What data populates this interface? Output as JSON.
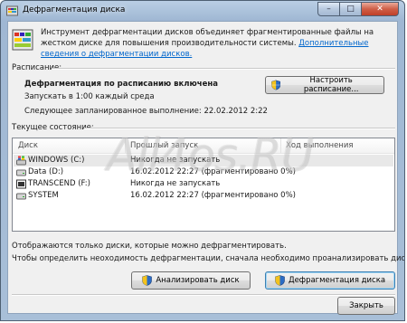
{
  "window": {
    "title": "Дефрагментация диска",
    "buttons": {
      "minimize": "–",
      "maximize": "□",
      "close": "✕"
    }
  },
  "intro": {
    "text": "Инструмент дефрагментации дисков объединяет фрагментированные файлы на жестком диске для повышения производительности системы. ",
    "link": "Дополнительные сведения о дефрагментации дисков."
  },
  "schedule": {
    "label": "Расписание:",
    "status": "Дефрагментация по расписанию включена",
    "run_at": "Запускать в 1:00 каждый среда",
    "next_run": "Следующее запланированное выполнение: 22.02.2012 2:22",
    "configure_button": "Настроить расписание..."
  },
  "current_state": {
    "label": "Текущее состояние:",
    "columns": [
      "Диск",
      "Прошлый запуск",
      "Ход выполнения"
    ],
    "rows": [
      {
        "disk": "WINDOWS (C:)",
        "last_run": "Никогда не запускать",
        "progress": ""
      },
      {
        "disk": "Data (D:)",
        "last_run": "16.02.2012 22:27 (фрагментировано 0%)",
        "progress": ""
      },
      {
        "disk": "TRANSCEND (F:)",
        "last_run": "Никогда не запускать",
        "progress": ""
      },
      {
        "disk": "SYSTEM",
        "last_run": "16.02.2012 22:27 (фрагментировано 0%)",
        "progress": ""
      }
    ]
  },
  "footer": {
    "note1": "Отображаются только диски, которые можно дефрагментировать.",
    "note2": "Чтобы определить неоходимость  дефрагментации, сначала необходимо проанализировать диски.",
    "analyze_button": "Анализировать диск",
    "defrag_button": "Дефрагментация диска",
    "close_button": "Закрыть"
  },
  "watermark": "All4os.RU",
  "colors": {
    "link": "#0066cc",
    "selection": "#e8e8e8",
    "close_button": "#c0402a"
  }
}
